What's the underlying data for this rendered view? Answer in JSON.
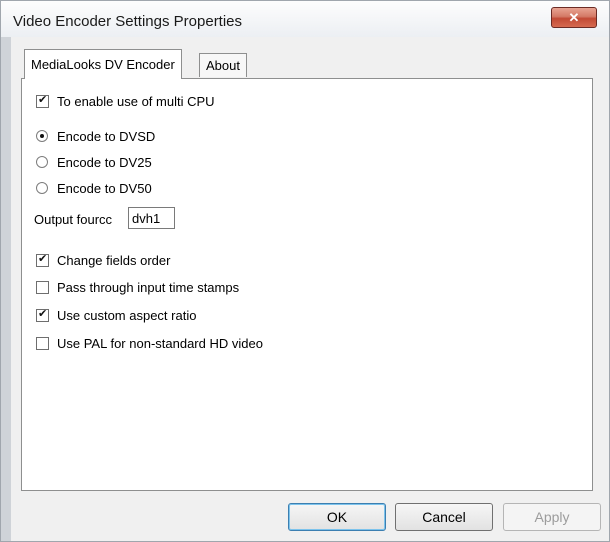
{
  "window": {
    "title": "Video Encoder Settings Properties"
  },
  "tabs": [
    {
      "label": "MediaLooks DV Encoder",
      "active": true
    },
    {
      "label": "About",
      "active": false
    }
  ],
  "options": {
    "multi_cpu": {
      "label": "To enable use of multi CPU",
      "checked": true
    },
    "encode": [
      {
        "label": "Encode to DVSD",
        "selected": true
      },
      {
        "label": "Encode to DV25",
        "selected": false
      },
      {
        "label": "Encode to DV50",
        "selected": false
      }
    ],
    "fourcc": {
      "label": "Output fourcc",
      "value": "dvh1"
    },
    "checkboxes": [
      {
        "label": "Change fields order",
        "checked": true
      },
      {
        "label": "Pass through input time stamps",
        "checked": false
      },
      {
        "label": "Use custom aspect ratio",
        "checked": true
      },
      {
        "label": "Use PAL for non-standard HD video",
        "checked": false
      }
    ]
  },
  "buttons": {
    "ok": "OK",
    "cancel": "Cancel",
    "apply": "Apply"
  },
  "icons": {
    "close": "close-icon"
  }
}
